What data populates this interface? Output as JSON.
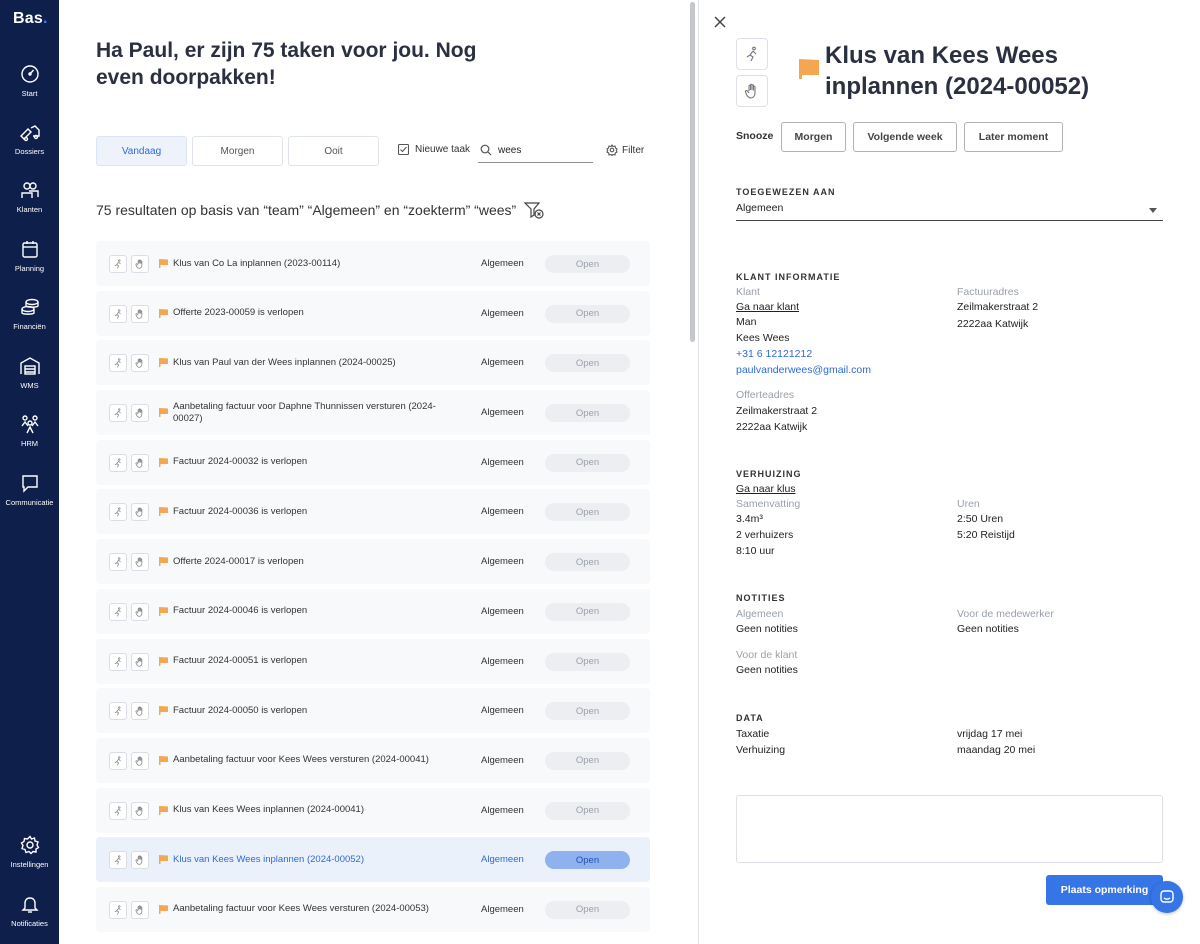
{
  "brand": {
    "name": "Bas",
    "dot": "."
  },
  "sidebar": {
    "top_items": [
      {
        "label": "Start",
        "icon": "gauge-icon"
      },
      {
        "label": "Dossiers",
        "icon": "truck-icon"
      },
      {
        "label": "Klanten",
        "icon": "users-icon"
      },
      {
        "label": "Planning",
        "icon": "calendar-icon"
      },
      {
        "label": "Financiën",
        "icon": "coins-icon"
      },
      {
        "label": "WMS",
        "icon": "warehouse-icon"
      },
      {
        "label": "HRM",
        "icon": "team-icon"
      },
      {
        "label": "Communicatie",
        "icon": "chat-icon"
      }
    ],
    "bottom_items": [
      {
        "label": "Instellingen",
        "icon": "gear-icon"
      },
      {
        "label": "Notificaties",
        "icon": "bell-icon"
      }
    ]
  },
  "main": {
    "greeting": "Ha Paul, er zijn 75 taken voor jou. Nog even doorpakken!",
    "tabs": [
      {
        "label": "Vandaag",
        "active": true
      },
      {
        "label": "Morgen",
        "active": false
      },
      {
        "label": "Ooit",
        "active": false
      }
    ],
    "new_task_label": "Nieuwe taak",
    "search_value": "wees",
    "filter_label": "Filter",
    "results_text": "75 resultaten op basis van “team” “Algemeen” en “zoekterm” “wees”",
    "tasks": [
      {
        "title": "Klus van Co La inplannen (2023-00114)",
        "team": "Algemeen",
        "status": "Open"
      },
      {
        "title": "Offerte 2023-00059 is verlopen",
        "team": "Algemeen",
        "status": "Open"
      },
      {
        "title": "Klus van Paul van der Wees inplannen (2024-00025)",
        "team": "Algemeen",
        "status": "Open"
      },
      {
        "title": "Aanbetaling factuur voor Daphne Thunnissen versturen (2024-00027)",
        "team": "Algemeen",
        "status": "Open"
      },
      {
        "title": "Factuur 2024-00032 is verlopen",
        "team": "Algemeen",
        "status": "Open"
      },
      {
        "title": "Factuur 2024-00036 is verlopen",
        "team": "Algemeen",
        "status": "Open"
      },
      {
        "title": "Offerte 2024-00017 is verlopen",
        "team": "Algemeen",
        "status": "Open"
      },
      {
        "title": "Factuur 2024-00046 is verlopen",
        "team": "Algemeen",
        "status": "Open"
      },
      {
        "title": "Factuur 2024-00051 is verlopen",
        "team": "Algemeen",
        "status": "Open"
      },
      {
        "title": "Factuur 2024-00050 is verlopen",
        "team": "Algemeen",
        "status": "Open"
      },
      {
        "title": "Aanbetaling factuur voor Kees Wees versturen (2024-00041)",
        "team": "Algemeen",
        "status": "Open"
      },
      {
        "title": "Klus van Kees Wees inplannen (2024-00041)",
        "team": "Algemeen",
        "status": "Open"
      },
      {
        "title": "Klus van Kees Wees inplannen (2024-00052)",
        "team": "Algemeen",
        "status": "Open",
        "selected": true
      },
      {
        "title": "Aanbetaling factuur voor Kees Wees versturen (2024-00053)",
        "team": "Algemeen",
        "status": "Open"
      }
    ]
  },
  "detail": {
    "title": "Klus van Kees Wees inplannen (2024-00052)",
    "snooze_label": "Snooze",
    "snooze_options": [
      "Morgen",
      "Volgende week",
      "Later moment"
    ],
    "assigned": {
      "title": "TOEGEWEZEN AAN",
      "value": "Algemeen"
    },
    "client": {
      "title": "KLANT INFORMATIE",
      "klant_label": "Klant",
      "klant_link": "Ga naar klant",
      "gender": "Man",
      "name": "Kees Wees",
      "phone": "+31 6 12121212",
      "email": "paulvanderwees@gmail.com",
      "factuur_label": "Factuuradres",
      "factuur_street": "Zeilmakerstraat 2",
      "factuur_city": "2222aa Katwijk",
      "offerte_label": "Offerteadres",
      "offerte_street": "Zeilmakerstraat 2",
      "offerte_city": "2222aa Katwijk"
    },
    "move": {
      "title": "VERHUIZING",
      "link": "Ga naar klus",
      "summary_label": "Samenvatting",
      "volume": "3.4m³",
      "movers": "2 verhuizers",
      "time": "8:10 uur",
      "hours_label": "Uren",
      "hours": "2:50 Uren",
      "travel": "5:20 Reistijd"
    },
    "notes": {
      "title": "NOTITIES",
      "general_label": "Algemeen",
      "general_value": "Geen notities",
      "employee_label": "Voor de medewerker",
      "employee_value": "Geen notities",
      "client_label": "Voor de klant",
      "client_value": "Geen notities"
    },
    "dates": {
      "title": "DATA",
      "taxatie_label": "Taxatie",
      "taxatie_value": "vrijdag 17 mei",
      "move_label": "Verhuizing",
      "move_value": "maandag 20 mei"
    },
    "post_button": "Plaats opmerking"
  },
  "colors": {
    "sidebar": "#0f1f4b",
    "accent": "#3575e6",
    "flag": "#f5a650"
  }
}
